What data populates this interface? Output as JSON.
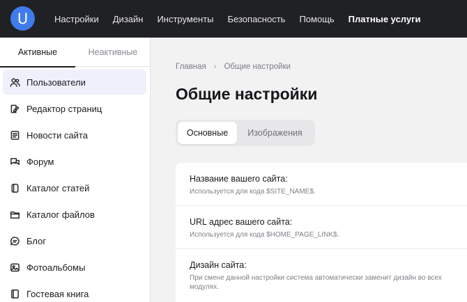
{
  "logo": {
    "letter": "U"
  },
  "topnav": {
    "items": [
      {
        "label": "Настройки"
      },
      {
        "label": "Дизайн"
      },
      {
        "label": "Инструменты"
      },
      {
        "label": "Безопасность"
      },
      {
        "label": "Помощь"
      },
      {
        "label": "Платные услуги"
      }
    ]
  },
  "sidebar": {
    "tabs": [
      {
        "label": "Активные",
        "active": true
      },
      {
        "label": "Неактивные",
        "active": false
      }
    ],
    "items": [
      {
        "label": "Пользователи",
        "icon": "users-icon",
        "active": true
      },
      {
        "label": "Редактор страниц",
        "icon": "page-edit-icon"
      },
      {
        "label": "Новости сайта",
        "icon": "news-icon"
      },
      {
        "label": "Форум",
        "icon": "forum-icon"
      },
      {
        "label": "Каталог статей",
        "icon": "articles-icon"
      },
      {
        "label": "Каталог файлов",
        "icon": "folder-icon"
      },
      {
        "label": "Блог",
        "icon": "blog-icon"
      },
      {
        "label": "Фотоальбомы",
        "icon": "photo-icon"
      },
      {
        "label": "Гостевая книга",
        "icon": "guestbook-icon"
      }
    ]
  },
  "breadcrumb": {
    "home": "Главная",
    "separator": "›",
    "current": "Общие настройки"
  },
  "page": {
    "title": "Общие настройки"
  },
  "tabs": [
    {
      "label": "Основные",
      "active": true
    },
    {
      "label": "Изображения",
      "active": false
    }
  ],
  "settings": [
    {
      "title": "Название вашего сайта:",
      "desc": "Используется для кода $SITE_NAME$."
    },
    {
      "title": "URL адрес вашего сайта:",
      "desc": "Используется для кода $HOME_PAGE_LINK$."
    },
    {
      "title": "Дизайн сайта:",
      "desc": "При смене данной настройки система автоматически заменит дизайн во всех модулях."
    }
  ],
  "colors": {
    "topbar": "#202124",
    "accent": "#3f7bea",
    "active_item_bg": "#eef0fb"
  }
}
